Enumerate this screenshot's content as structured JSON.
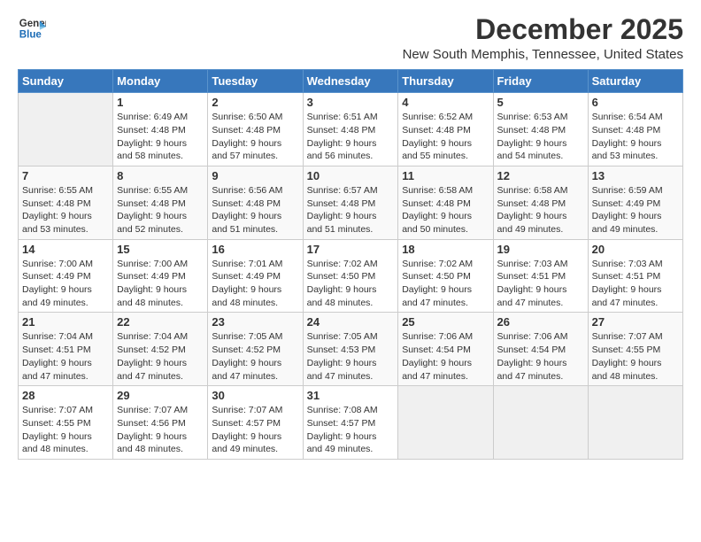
{
  "header": {
    "logo_line1": "General",
    "logo_line2": "Blue",
    "title": "December 2025",
    "subtitle": "New South Memphis, Tennessee, United States"
  },
  "calendar": {
    "days_of_week": [
      "Sunday",
      "Monday",
      "Tuesday",
      "Wednesday",
      "Thursday",
      "Friday",
      "Saturday"
    ],
    "weeks": [
      [
        {
          "day": "",
          "info": ""
        },
        {
          "day": "1",
          "info": "Sunrise: 6:49 AM\nSunset: 4:48 PM\nDaylight: 9 hours\nand 58 minutes."
        },
        {
          "day": "2",
          "info": "Sunrise: 6:50 AM\nSunset: 4:48 PM\nDaylight: 9 hours\nand 57 minutes."
        },
        {
          "day": "3",
          "info": "Sunrise: 6:51 AM\nSunset: 4:48 PM\nDaylight: 9 hours\nand 56 minutes."
        },
        {
          "day": "4",
          "info": "Sunrise: 6:52 AM\nSunset: 4:48 PM\nDaylight: 9 hours\nand 55 minutes."
        },
        {
          "day": "5",
          "info": "Sunrise: 6:53 AM\nSunset: 4:48 PM\nDaylight: 9 hours\nand 54 minutes."
        },
        {
          "day": "6",
          "info": "Sunrise: 6:54 AM\nSunset: 4:48 PM\nDaylight: 9 hours\nand 53 minutes."
        }
      ],
      [
        {
          "day": "7",
          "info": "Sunrise: 6:55 AM\nSunset: 4:48 PM\nDaylight: 9 hours\nand 53 minutes."
        },
        {
          "day": "8",
          "info": "Sunrise: 6:55 AM\nSunset: 4:48 PM\nDaylight: 9 hours\nand 52 minutes."
        },
        {
          "day": "9",
          "info": "Sunrise: 6:56 AM\nSunset: 4:48 PM\nDaylight: 9 hours\nand 51 minutes."
        },
        {
          "day": "10",
          "info": "Sunrise: 6:57 AM\nSunset: 4:48 PM\nDaylight: 9 hours\nand 51 minutes."
        },
        {
          "day": "11",
          "info": "Sunrise: 6:58 AM\nSunset: 4:48 PM\nDaylight: 9 hours\nand 50 minutes."
        },
        {
          "day": "12",
          "info": "Sunrise: 6:58 AM\nSunset: 4:48 PM\nDaylight: 9 hours\nand 49 minutes."
        },
        {
          "day": "13",
          "info": "Sunrise: 6:59 AM\nSunset: 4:49 PM\nDaylight: 9 hours\nand 49 minutes."
        }
      ],
      [
        {
          "day": "14",
          "info": "Sunrise: 7:00 AM\nSunset: 4:49 PM\nDaylight: 9 hours\nand 49 minutes."
        },
        {
          "day": "15",
          "info": "Sunrise: 7:00 AM\nSunset: 4:49 PM\nDaylight: 9 hours\nand 48 minutes."
        },
        {
          "day": "16",
          "info": "Sunrise: 7:01 AM\nSunset: 4:49 PM\nDaylight: 9 hours\nand 48 minutes."
        },
        {
          "day": "17",
          "info": "Sunrise: 7:02 AM\nSunset: 4:50 PM\nDaylight: 9 hours\nand 48 minutes."
        },
        {
          "day": "18",
          "info": "Sunrise: 7:02 AM\nSunset: 4:50 PM\nDaylight: 9 hours\nand 47 minutes."
        },
        {
          "day": "19",
          "info": "Sunrise: 7:03 AM\nSunset: 4:51 PM\nDaylight: 9 hours\nand 47 minutes."
        },
        {
          "day": "20",
          "info": "Sunrise: 7:03 AM\nSunset: 4:51 PM\nDaylight: 9 hours\nand 47 minutes."
        }
      ],
      [
        {
          "day": "21",
          "info": "Sunrise: 7:04 AM\nSunset: 4:51 PM\nDaylight: 9 hours\nand 47 minutes."
        },
        {
          "day": "22",
          "info": "Sunrise: 7:04 AM\nSunset: 4:52 PM\nDaylight: 9 hours\nand 47 minutes."
        },
        {
          "day": "23",
          "info": "Sunrise: 7:05 AM\nSunset: 4:52 PM\nDaylight: 9 hours\nand 47 minutes."
        },
        {
          "day": "24",
          "info": "Sunrise: 7:05 AM\nSunset: 4:53 PM\nDaylight: 9 hours\nand 47 minutes."
        },
        {
          "day": "25",
          "info": "Sunrise: 7:06 AM\nSunset: 4:54 PM\nDaylight: 9 hours\nand 47 minutes."
        },
        {
          "day": "26",
          "info": "Sunrise: 7:06 AM\nSunset: 4:54 PM\nDaylight: 9 hours\nand 47 minutes."
        },
        {
          "day": "27",
          "info": "Sunrise: 7:07 AM\nSunset: 4:55 PM\nDaylight: 9 hours\nand 48 minutes."
        }
      ],
      [
        {
          "day": "28",
          "info": "Sunrise: 7:07 AM\nSunset: 4:55 PM\nDaylight: 9 hours\nand 48 minutes."
        },
        {
          "day": "29",
          "info": "Sunrise: 7:07 AM\nSunset: 4:56 PM\nDaylight: 9 hours\nand 48 minutes."
        },
        {
          "day": "30",
          "info": "Sunrise: 7:07 AM\nSunset: 4:57 PM\nDaylight: 9 hours\nand 49 minutes."
        },
        {
          "day": "31",
          "info": "Sunrise: 7:08 AM\nSunset: 4:57 PM\nDaylight: 9 hours\nand 49 minutes."
        },
        {
          "day": "",
          "info": ""
        },
        {
          "day": "",
          "info": ""
        },
        {
          "day": "",
          "info": ""
        }
      ]
    ]
  }
}
